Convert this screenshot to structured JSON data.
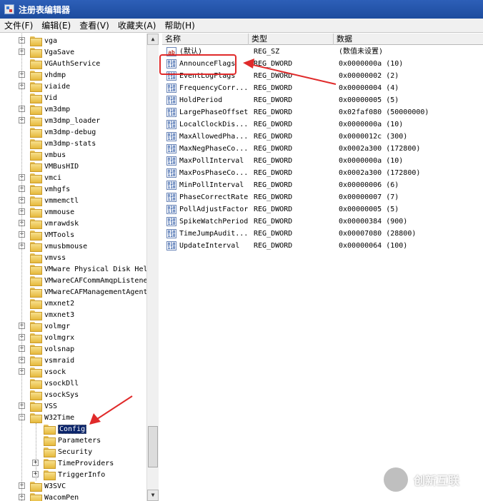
{
  "window": {
    "title": "注册表编辑器"
  },
  "menu": [
    "文件(F)",
    "编辑(E)",
    "查看(V)",
    "收藏夹(A)",
    "帮助(H)"
  ],
  "tree": [
    {
      "label": "vga",
      "expander": "+",
      "level": 0
    },
    {
      "label": "VgaSave",
      "expander": "+",
      "level": 0
    },
    {
      "label": "VGAuthService",
      "expander": "",
      "level": 0
    },
    {
      "label": "vhdmp",
      "expander": "+",
      "level": 0
    },
    {
      "label": "viaide",
      "expander": "+",
      "level": 0
    },
    {
      "label": "Vid",
      "expander": "",
      "level": 0
    },
    {
      "label": "vm3dmp",
      "expander": "+",
      "level": 0
    },
    {
      "label": "vm3dmp_loader",
      "expander": "+",
      "level": 0
    },
    {
      "label": "vm3dmp-debug",
      "expander": "",
      "level": 0
    },
    {
      "label": "vm3dmp-stats",
      "expander": "",
      "level": 0
    },
    {
      "label": "vmbus",
      "expander": "",
      "level": 0
    },
    {
      "label": "VMBusHID",
      "expander": "",
      "level": 0
    },
    {
      "label": "vmci",
      "expander": "+",
      "level": 0
    },
    {
      "label": "vmhgfs",
      "expander": "+",
      "level": 0
    },
    {
      "label": "vmmemctl",
      "expander": "+",
      "level": 0
    },
    {
      "label": "vmmouse",
      "expander": "+",
      "level": 0
    },
    {
      "label": "vmrawdsk",
      "expander": "+",
      "level": 0
    },
    {
      "label": "VMTools",
      "expander": "+",
      "level": 0
    },
    {
      "label": "vmusbmouse",
      "expander": "+",
      "level": 0
    },
    {
      "label": "vmvss",
      "expander": "",
      "level": 0
    },
    {
      "label": "VMware Physical Disk Hel",
      "expander": "",
      "level": 0
    },
    {
      "label": "VMwareCAFCommAmqpListene",
      "expander": "",
      "level": 0
    },
    {
      "label": "VMwareCAFManagementAgent",
      "expander": "",
      "level": 0
    },
    {
      "label": "vmxnet2",
      "expander": "",
      "level": 0
    },
    {
      "label": "vmxnet3",
      "expander": "",
      "level": 0
    },
    {
      "label": "volmgr",
      "expander": "+",
      "level": 0
    },
    {
      "label": "volmgrx",
      "expander": "+",
      "level": 0
    },
    {
      "label": "volsnap",
      "expander": "+",
      "level": 0
    },
    {
      "label": "vsmraid",
      "expander": "+",
      "level": 0
    },
    {
      "label": "vsock",
      "expander": "+",
      "level": 0
    },
    {
      "label": "vsockDll",
      "expander": "",
      "level": 0
    },
    {
      "label": "vsockSys",
      "expander": "",
      "level": 0
    },
    {
      "label": "VSS",
      "expander": "+",
      "level": 0
    },
    {
      "label": "W32Time",
      "expander": "-",
      "level": 0
    },
    {
      "label": "Config",
      "expander": "",
      "level": 1,
      "selected": true
    },
    {
      "label": "Parameters",
      "expander": "",
      "level": 1
    },
    {
      "label": "Security",
      "expander": "",
      "level": 1
    },
    {
      "label": "TimeProviders",
      "expander": "+",
      "level": 1
    },
    {
      "label": "TriggerInfo",
      "expander": "+",
      "level": 1
    },
    {
      "label": "W3SVC",
      "expander": "+",
      "level": 0
    },
    {
      "label": "WacomPen",
      "expander": "+",
      "level": 0
    }
  ],
  "list": {
    "columns": [
      "名称",
      "类型",
      "数据"
    ],
    "rows": [
      {
        "icon": "string-value-icon",
        "name": "(默认)",
        "type": "REG_SZ",
        "data": "(数值未设置)"
      },
      {
        "icon": "dword-value-icon",
        "name": "AnnounceFlags",
        "type": "REG_DWORD",
        "data": "0x0000000a (10)"
      },
      {
        "icon": "dword-value-icon",
        "name": "EventLogFlags",
        "type": "REG_DWORD",
        "data": "0x00000002 (2)"
      },
      {
        "icon": "dword-value-icon",
        "name": "FrequencyCorr...",
        "type": "REG_DWORD",
        "data": "0x00000004 (4)"
      },
      {
        "icon": "dword-value-icon",
        "name": "HoldPeriod",
        "type": "REG_DWORD",
        "data": "0x00000005 (5)"
      },
      {
        "icon": "dword-value-icon",
        "name": "LargePhaseOffset",
        "type": "REG_DWORD",
        "data": "0x02faf080 (50000000)"
      },
      {
        "icon": "dword-value-icon",
        "name": "LocalClockDis...",
        "type": "REG_DWORD",
        "data": "0x0000000a (10)"
      },
      {
        "icon": "dword-value-icon",
        "name": "MaxAllowedPha...",
        "type": "REG_DWORD",
        "data": "0x0000012c (300)"
      },
      {
        "icon": "dword-value-icon",
        "name": "MaxNegPhaseCo...",
        "type": "REG_DWORD",
        "data": "0x0002a300 (172800)"
      },
      {
        "icon": "dword-value-icon",
        "name": "MaxPollInterval",
        "type": "REG_DWORD",
        "data": "0x0000000a (10)"
      },
      {
        "icon": "dword-value-icon",
        "name": "MaxPosPhaseCo...",
        "type": "REG_DWORD",
        "data": "0x0002a300 (172800)"
      },
      {
        "icon": "dword-value-icon",
        "name": "MinPollInterval",
        "type": "REG_DWORD",
        "data": "0x00000006 (6)"
      },
      {
        "icon": "dword-value-icon",
        "name": "PhaseCorrectRate",
        "type": "REG_DWORD",
        "data": "0x00000007 (7)"
      },
      {
        "icon": "dword-value-icon",
        "name": "PollAdjustFactor",
        "type": "REG_DWORD",
        "data": "0x00000005 (5)"
      },
      {
        "icon": "dword-value-icon",
        "name": "SpikeWatchPeriod",
        "type": "REG_DWORD",
        "data": "0x00000384 (900)"
      },
      {
        "icon": "dword-value-icon",
        "name": "TimeJumpAudit...",
        "type": "REG_DWORD",
        "data": "0x00007080 (28800)"
      },
      {
        "icon": "dword-value-icon",
        "name": "UpdateInterval",
        "type": "REG_DWORD",
        "data": "0x00000064 (100)"
      }
    ]
  },
  "watermark": {
    "text": "创新互联"
  },
  "colors": {
    "title_bar": "#1d4c9e",
    "selection": "#0a246a",
    "annotation": "#e02a2a"
  }
}
